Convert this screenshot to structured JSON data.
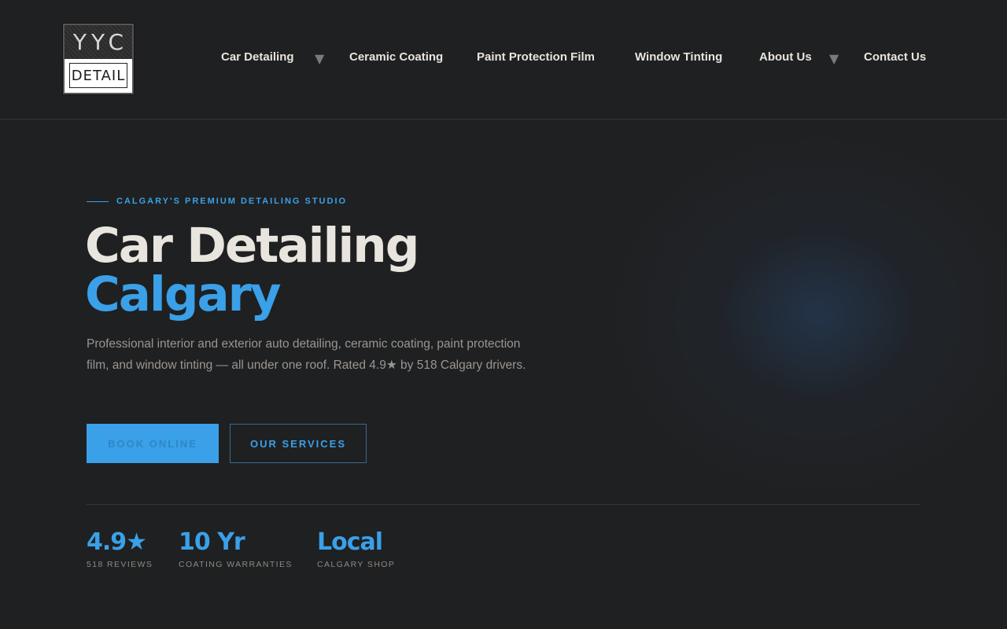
{
  "header": {
    "logo": {
      "top_text": "YYC",
      "bottom_text": "DETAIL"
    },
    "nav": [
      {
        "label": "Car Detailing",
        "has_dropdown": true
      },
      {
        "label": "Ceramic Coating",
        "has_dropdown": false
      },
      {
        "label": "Paint Protection Film",
        "has_dropdown": false
      },
      {
        "label": "Window Tinting",
        "has_dropdown": false
      },
      {
        "label": "About Us",
        "has_dropdown": true
      },
      {
        "label": "Contact Us",
        "has_dropdown": false
      }
    ],
    "caret_glyph": "▼"
  },
  "hero": {
    "eyebrow": "CALGARY'S PREMIUM DETAILING STUDIO",
    "title_line1": "Car Detailing",
    "title_line2": "Calgary",
    "lead": "Professional interior and exterior auto detailing, ceramic coating, paint protection film, and window tinting — all under one roof. Rated 4.9★ by 518 Calgary drivers.",
    "primary_button": "BOOK ONLINE",
    "secondary_button": "OUR SERVICES"
  },
  "stats": [
    {
      "value": "4.9★",
      "label": "518 REVIEWS"
    },
    {
      "value": "10 Yr",
      "label": "COATING WARRANTIES"
    },
    {
      "value": "Local",
      "label": "CALGARY SHOP"
    }
  ],
  "colors": {
    "background": "#1f2021",
    "accent": "#3aa0e8",
    "text": "#e8e4de",
    "muted": "#9a9693"
  }
}
